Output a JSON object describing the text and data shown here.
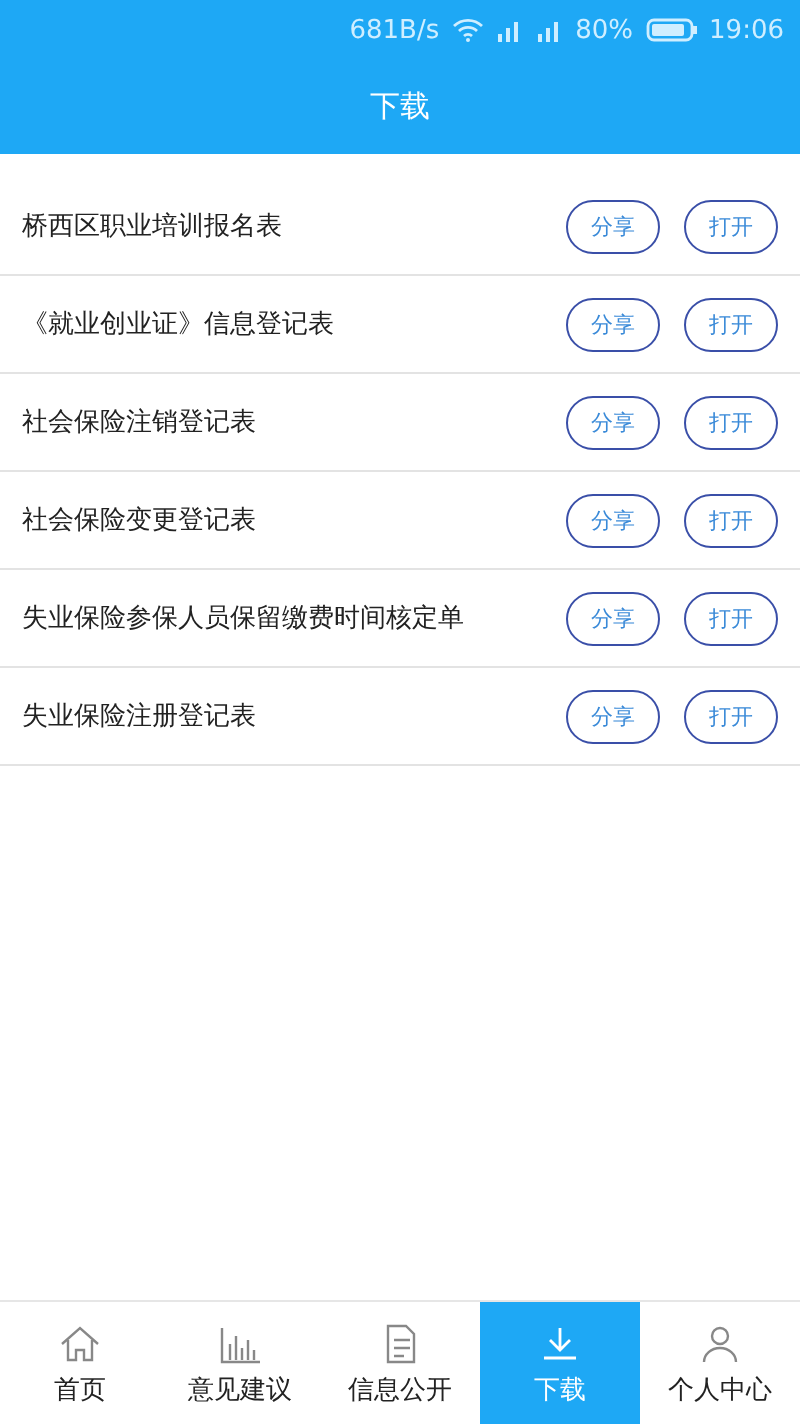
{
  "status_bar": {
    "speed": "681B/s",
    "battery": "80%",
    "time": "19:06"
  },
  "header": {
    "title": "下载"
  },
  "files": [
    {
      "name": "桥西区职业培训报名表",
      "share": "分享",
      "open": "打开"
    },
    {
      "name": "《就业创业证》信息登记表",
      "share": "分享",
      "open": "打开"
    },
    {
      "name": "社会保险注销登记表",
      "share": "分享",
      "open": "打开"
    },
    {
      "name": "社会保险变更登记表",
      "share": "分享",
      "open": "打开"
    },
    {
      "name": "失业保险参保人员保留缴费时间核定单",
      "share": "分享",
      "open": "打开"
    },
    {
      "name": "失业保险注册登记表",
      "share": "分享",
      "open": "打开"
    }
  ],
  "nav": [
    {
      "label": "首页",
      "selected": false
    },
    {
      "label": "意见建议",
      "selected": false
    },
    {
      "label": "信息公开",
      "selected": false
    },
    {
      "label": "下载",
      "selected": true
    },
    {
      "label": "个人中心",
      "selected": false
    }
  ]
}
